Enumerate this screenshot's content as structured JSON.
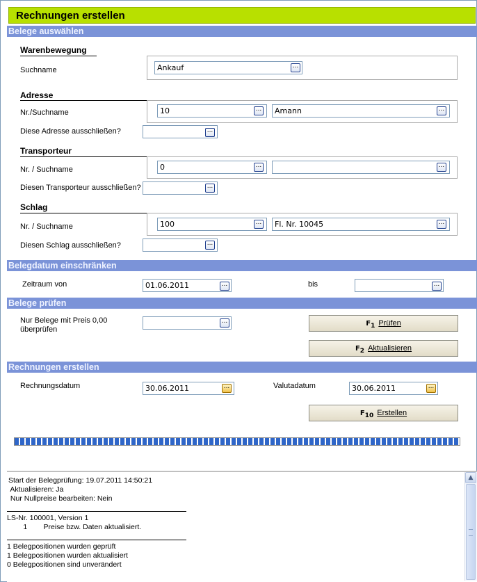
{
  "title": "Rechnungen erstellen",
  "sections": {
    "belege_auswaehlen": "Belege auswählen",
    "belegdatum": "Belegdatum einschränken",
    "belege_pruefen": "Belege prüfen",
    "rechnungen_erstellen": "Rechnungen erstellen"
  },
  "warenbewegung": {
    "heading": "Warenbewegung",
    "suchname_label": "Suchname",
    "suchname_value": "Ankauf"
  },
  "adresse": {
    "heading": "Adresse",
    "nr_label": "Nr./Suchname",
    "nr_value": "10",
    "name_value": "Amann",
    "exclude_label": "Diese Adresse ausschließen?",
    "exclude_value": ""
  },
  "transporteur": {
    "heading": "Transporteur",
    "nr_label": "Nr. / Suchname",
    "nr_value": "0",
    "name_value": "",
    "exclude_label": "Diesen Transporteur ausschließen?",
    "exclude_value": ""
  },
  "schlag": {
    "heading": "Schlag",
    "nr_label": "Nr. / Suchname",
    "nr_value": "100",
    "name_value": "Fl. Nr. 10045",
    "exclude_label": "Diesen Schlag ausschließen?",
    "exclude_value": ""
  },
  "zeitraum": {
    "von_label": "Zeitraum von",
    "von_value": "01.06.2011",
    "bis_label": "bis",
    "bis_value": ""
  },
  "pruefen": {
    "nullpreis_label_1": "Nur Belege mit Preis 0,00",
    "nullpreis_label_2": "überprüfen",
    "nullpreis_value": "",
    "pruefen_key": "F",
    "pruefen_key_num": "1",
    "pruefen_button": "Prüfen",
    "aktualisieren_key": "F",
    "aktualisieren_key_num": "2",
    "aktualisieren_button": "Aktualisieren"
  },
  "erstellen": {
    "rechnungsdatum_label": "Rechnungsdatum",
    "rechnungsdatum_value": "30.06.2011",
    "valutadatum_label": "Valutadatum",
    "valutadatum_value": "30.06.2011",
    "erstellen_key": "F",
    "erstellen_key_num": "10",
    "erstellen_button": "Erstellen"
  },
  "progress": {
    "fraction": 1.0
  },
  "log": {
    "line1": "Start der Belegprüfung: 19.07.2011 14:50:21",
    "line2": " Aktualisieren: Ja",
    "line3": " Nur Nullpreise bearbeiten: Nein",
    "line4": "LS-Nr. 100001, Version 1",
    "line5": "        1        Preise bzw. Daten aktualisiert.",
    "line6": "1 Belegpositionen wurden geprüft",
    "line7": "1 Belegpositionen wurden aktualisiert",
    "line8": "0 Belegpositionen sind unverändert"
  },
  "icons": {
    "ellipsis": "...",
    "scroll_up": "▲"
  },
  "colors": {
    "title_bg": "#b8e000",
    "section_bg": "#7b93d8",
    "progress": "#2f66c8"
  }
}
